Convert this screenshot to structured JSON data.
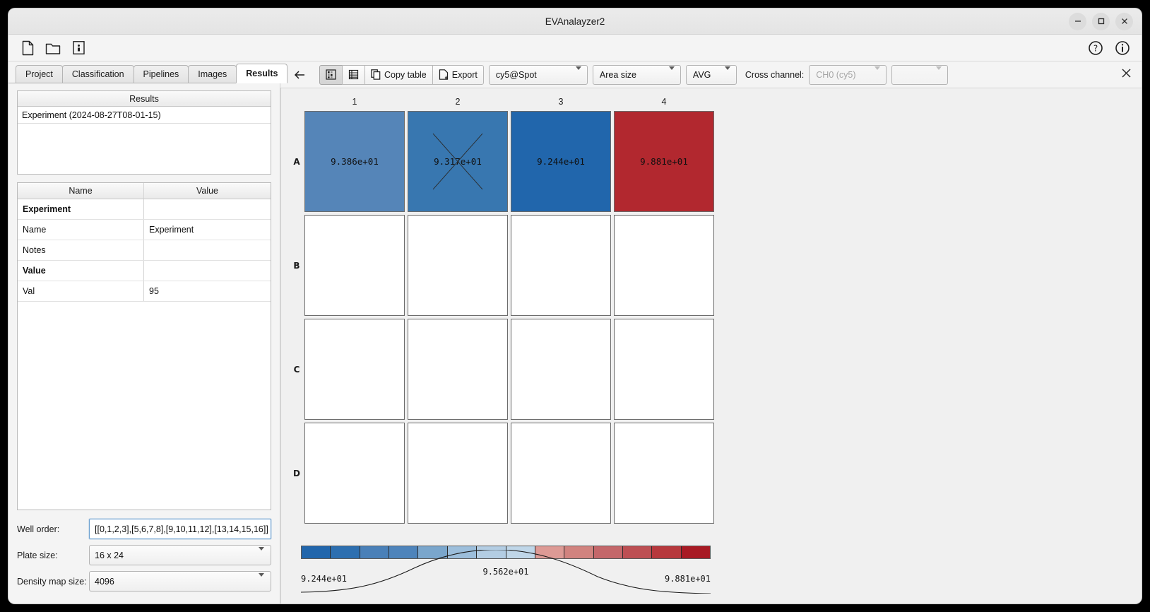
{
  "window": {
    "title": "EVAnalayzer2",
    "controls": [
      {
        "name": "minimize",
        "glyph": "minimize-icon"
      },
      {
        "name": "maximize",
        "glyph": "maximize-icon"
      },
      {
        "name": "close",
        "glyph": "close-icon"
      }
    ]
  },
  "filebar": {
    "icons": [
      {
        "name": "new-file-icon"
      },
      {
        "name": "open-folder-icon"
      },
      {
        "name": "save-icon"
      }
    ],
    "right_icons": [
      {
        "name": "help-icon"
      },
      {
        "name": "info-icon"
      }
    ]
  },
  "tabs": [
    {
      "label": "Project",
      "active": false
    },
    {
      "label": "Classification",
      "active": false
    },
    {
      "label": "Pipelines",
      "active": false
    },
    {
      "label": "Images",
      "active": false
    },
    {
      "label": "Results",
      "active": true
    }
  ],
  "results_list": {
    "header": "Results",
    "rows": [
      "Experiment (2024-08-27T08-01-15)"
    ]
  },
  "properties_table": {
    "columns": [
      "Name",
      "Value"
    ],
    "rows": [
      {
        "name": "Experiment",
        "value": "",
        "group": true
      },
      {
        "name": "Name",
        "value": "Experiment",
        "group": false
      },
      {
        "name": "Notes",
        "value": "",
        "group": false
      },
      {
        "name": "Value",
        "value": "",
        "group": true
      },
      {
        "name": "Val",
        "value": "95",
        "group": false
      }
    ]
  },
  "form": {
    "well_order": {
      "label": "Well order:",
      "value": "[[0,1,2,3],[5,6,7,8],[9,10,11,12],[13,14,15,16]]"
    },
    "plate_size": {
      "label": "Plate size:",
      "value": "16 x 24"
    },
    "density_map_size": {
      "label": "Density map size:",
      "value": "4096"
    }
  },
  "heatmap_toolbar": {
    "back_icon": "back-arrow-icon",
    "heatmap_view_icon": "heatmap-view-icon",
    "table_view_icon": "table-view-icon",
    "copy_table_label": "Copy table",
    "copy_table_icon": "copy-icon",
    "export_label": "Export",
    "export_icon": "export-icon",
    "channel_select": "cy5@Spot",
    "measure_select": "Area size",
    "stat_select": "AVG",
    "cross_channel_label": "Cross channel:",
    "cross_channel_select": "CH0 (cy5)",
    "cross_channel_select2": "",
    "close_icon": "close-icon"
  },
  "chart_data": {
    "type": "heatmap",
    "title": "",
    "xlabel": "",
    "ylabel": "",
    "col_labels": [
      "1",
      "2",
      "3",
      "4"
    ],
    "row_labels": [
      "A",
      "B",
      "C",
      "D"
    ],
    "value_format": "scientific",
    "cells": [
      [
        {
          "well": "A1",
          "value": 93.86,
          "text": "9.386e+01",
          "color": "#5585b8",
          "excluded": false
        },
        {
          "well": "A2",
          "value": 93.17,
          "text": "9.317e+01",
          "color": "#3877b0",
          "excluded": true
        },
        {
          "well": "A3",
          "value": 92.44,
          "text": "9.244e+01",
          "color": "#2166ac",
          "excluded": false
        },
        {
          "well": "A4",
          "value": 98.81,
          "text": "9.881e+01",
          "color": "#b2282f",
          "excluded": false
        }
      ],
      [
        {
          "well": "B1",
          "value": null,
          "text": "",
          "color": "#ffffff",
          "excluded": false
        },
        {
          "well": "B2",
          "value": null,
          "text": "",
          "color": "#ffffff",
          "excluded": false
        },
        {
          "well": "B3",
          "value": null,
          "text": "",
          "color": "#ffffff",
          "excluded": false
        },
        {
          "well": "B4",
          "value": null,
          "text": "",
          "color": "#ffffff",
          "excluded": false
        }
      ],
      [
        {
          "well": "C1",
          "value": null,
          "text": "",
          "color": "#ffffff",
          "excluded": false
        },
        {
          "well": "C2",
          "value": null,
          "text": "",
          "color": "#ffffff",
          "excluded": false
        },
        {
          "well": "C3",
          "value": null,
          "text": "",
          "color": "#ffffff",
          "excluded": false
        },
        {
          "well": "C4",
          "value": null,
          "text": "",
          "color": "#ffffff",
          "excluded": false
        }
      ],
      [
        {
          "well": "D1",
          "value": null,
          "text": "",
          "color": "#ffffff",
          "excluded": false
        },
        {
          "well": "D2",
          "value": null,
          "text": "",
          "color": "#ffffff",
          "excluded": false
        },
        {
          "well": "D3",
          "value": null,
          "text": "",
          "color": "#ffffff",
          "excluded": false
        },
        {
          "well": "D4",
          "value": null,
          "text": "",
          "color": "#ffffff",
          "excluded": false
        }
      ]
    ],
    "colorbar": {
      "min_label": "9.244e+01",
      "mid_label": "9.562e+01",
      "max_label": "9.881e+01",
      "min": 92.44,
      "mid": 95.62,
      "max": 98.81,
      "colors": [
        "#2166ac",
        "#2d6fb0",
        "#4a80b8",
        "#4e84bb",
        "#7aa6cc",
        "#9cbedb",
        "#b3cde3",
        "#bfd6e8",
        "#dd9a95",
        "#d1837f",
        "#c4676a",
        "#bd4f53",
        "#b7383d",
        "#a81a24"
      ],
      "segments": 14,
      "density_curve": true
    }
  }
}
